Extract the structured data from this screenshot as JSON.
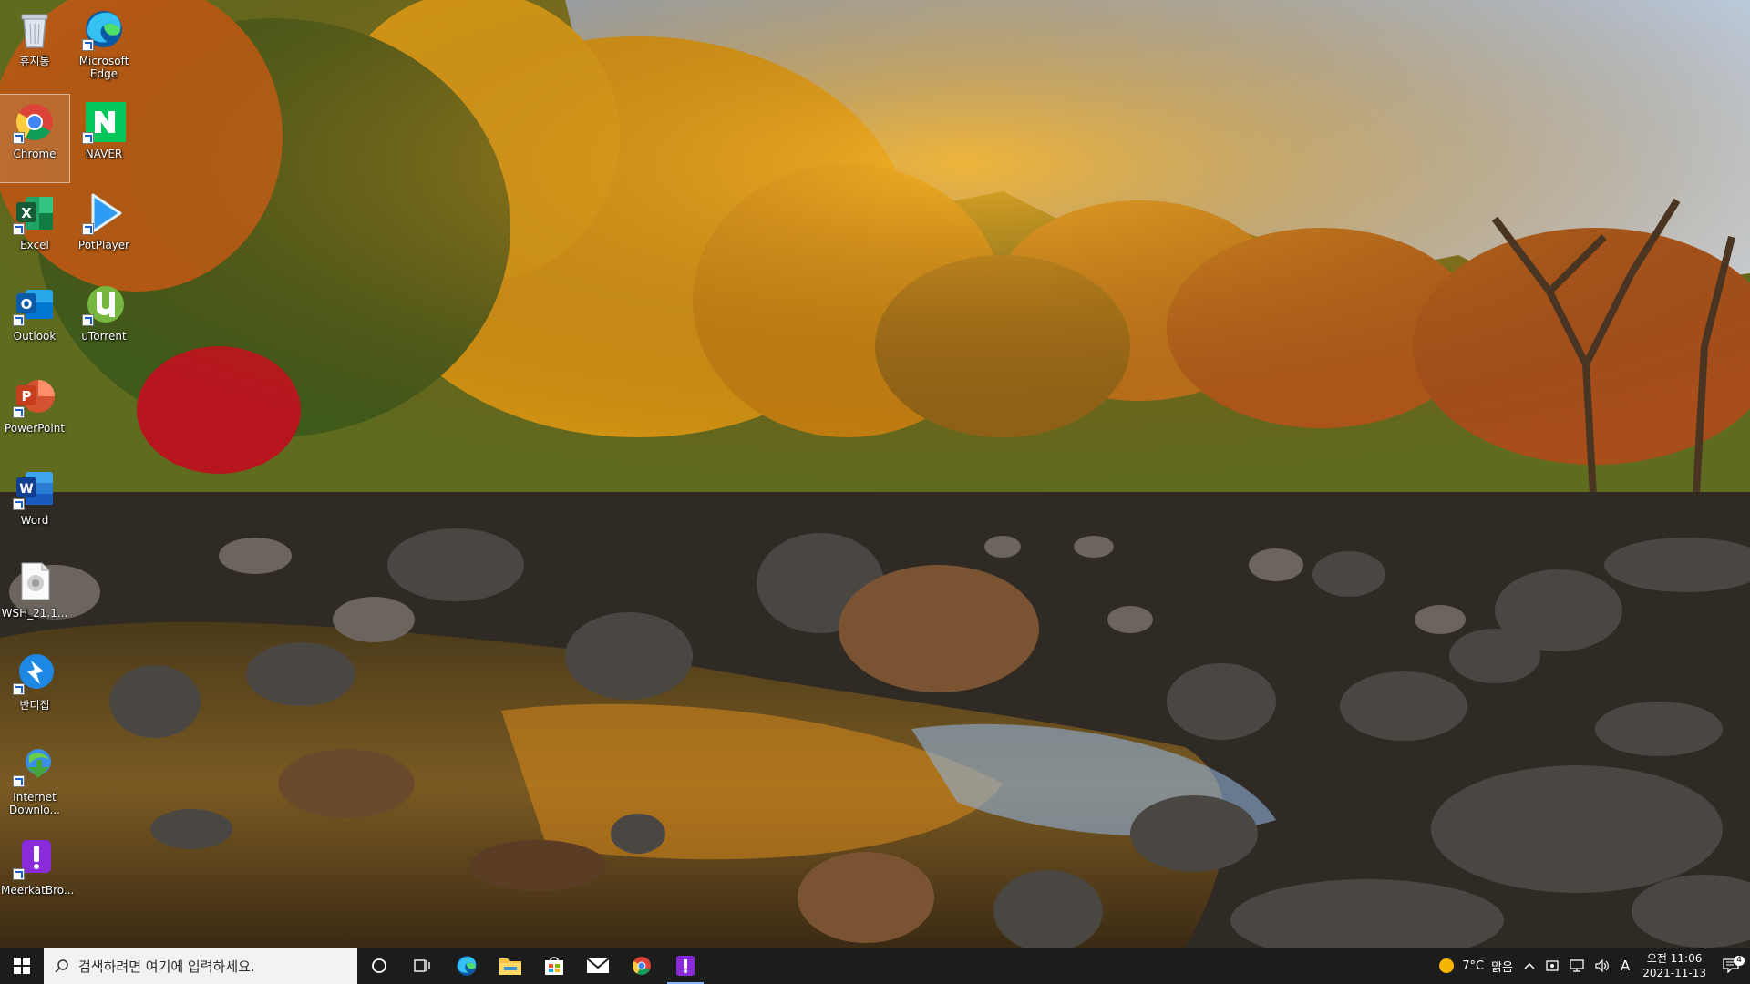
{
  "desktop": {
    "icons": [
      {
        "label": "휴지통",
        "icon": "recycle-bin-icon"
      },
      {
        "label": "Microsoft Edge",
        "icon": "edge-icon"
      },
      {
        "label": "Chrome",
        "icon": "chrome-icon"
      },
      {
        "label": "NAVER",
        "icon": "naver-icon"
      },
      {
        "label": "Excel",
        "icon": "excel-icon"
      },
      {
        "label": "PotPlayer",
        "icon": "potplayer-icon"
      },
      {
        "label": "Outlook",
        "icon": "outlook-icon"
      },
      {
        "label": "uTorrent",
        "icon": "utorrent-icon"
      },
      {
        "label": "PowerPoint",
        "icon": "powerpoint-icon"
      },
      {
        "label": "Word",
        "icon": "word-icon"
      },
      {
        "label": "WSH_21.1...",
        "icon": "document-icon"
      },
      {
        "label": "반디집",
        "icon": "bandizip-icon"
      },
      {
        "label": "Internet Downlo...",
        "icon": "idm-icon"
      },
      {
        "label": "MeerkatBro...",
        "icon": "meerkat-icon"
      }
    ],
    "selected_icon": "Chrome"
  },
  "taskbar": {
    "search_placeholder": "검색하려면 여기에 입력하세요.",
    "pinned": [
      "start-icon",
      "cortana-icon",
      "task-view-icon",
      "edge-icon",
      "file-explorer-icon",
      "store-icon",
      "mail-icon",
      "chrome-icon",
      "meerkat-icon"
    ],
    "active_app": "meerkat-icon",
    "weather": {
      "temp": "7°C",
      "condition": "맑음"
    },
    "ime": "A",
    "clock": {
      "time": "오전 11:06",
      "date": "2021-11-13"
    },
    "notification_count": "4"
  },
  "colors": {
    "taskbar_bg": "#1c1c1c",
    "search_bg": "#f2f2f2",
    "active_indicator": "#8ab4f8"
  }
}
